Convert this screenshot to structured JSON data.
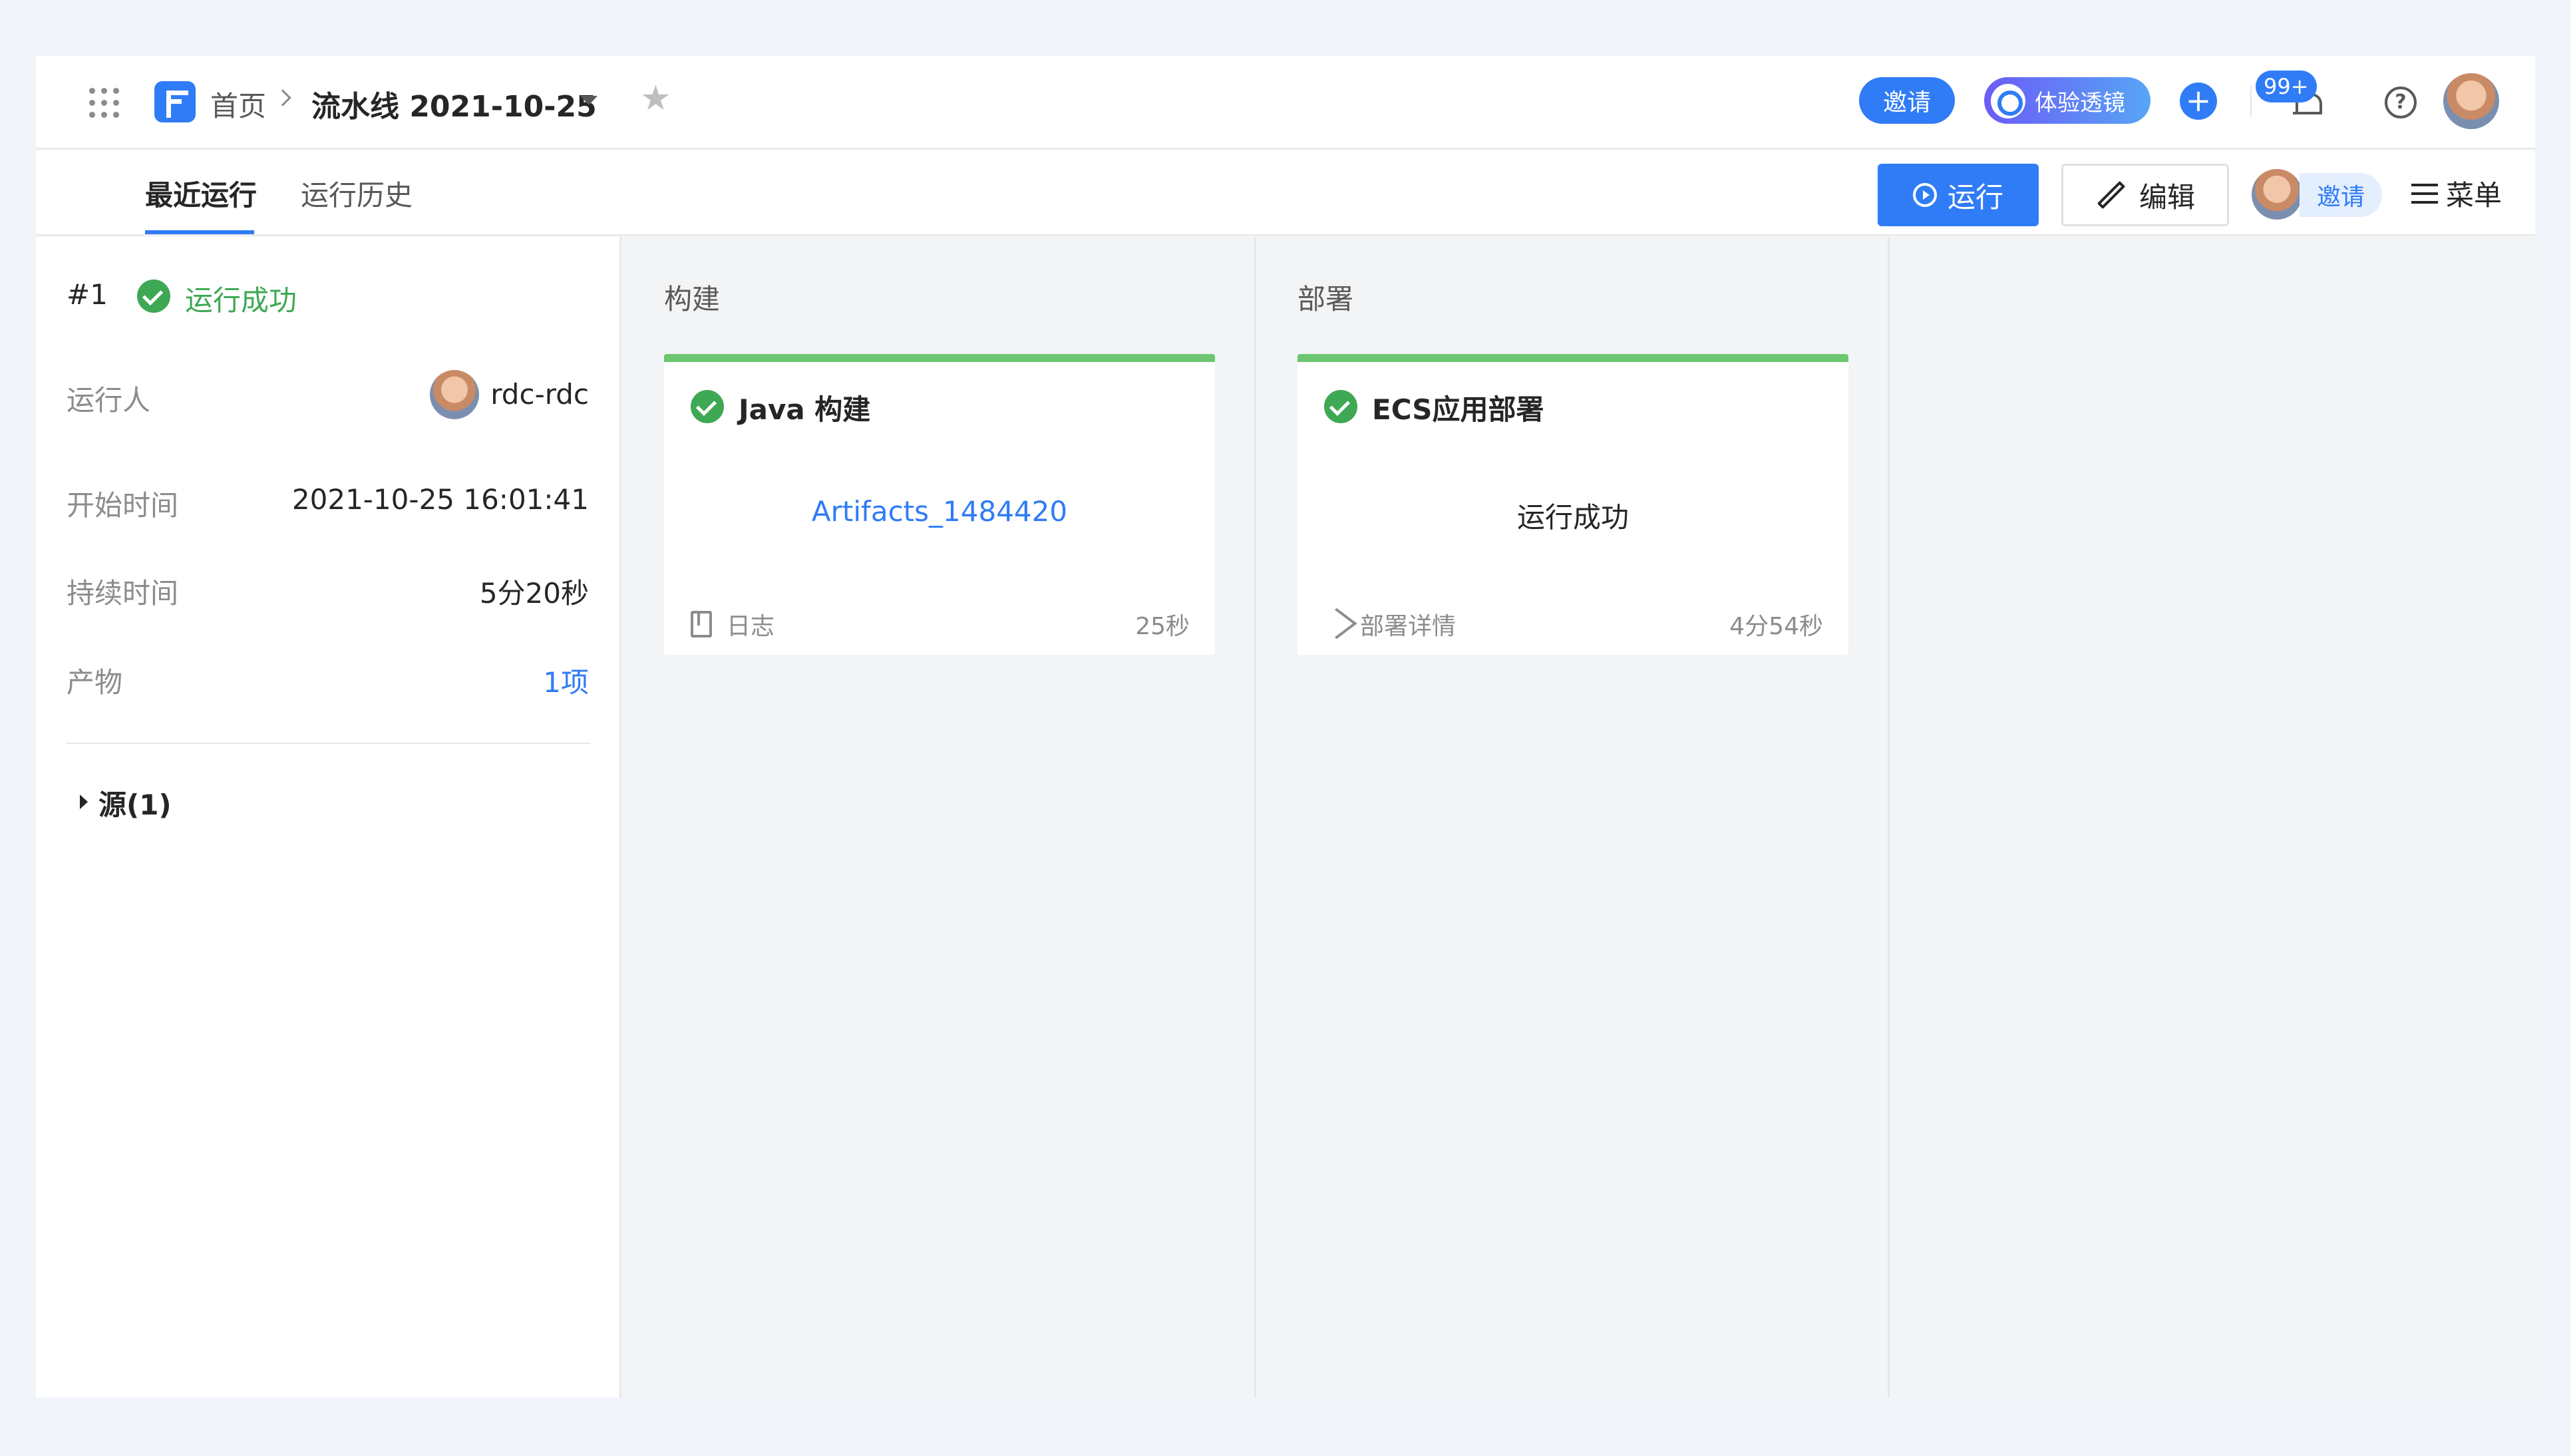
{
  "header": {
    "breadcrumb_home": "首页",
    "pipeline_name": "流水线 2021-10-25",
    "invite_label": "邀请",
    "lens_label": "体验透镜",
    "plus_label": "+",
    "notifications_badge": "99+",
    "help_label": "?"
  },
  "tabs": {
    "recent": "最近运行",
    "history": "运行历史",
    "run_button": "运行",
    "edit_button": "编辑",
    "invite_label": "邀请",
    "menu_label": "菜单"
  },
  "run_summary": {
    "run_number": "#1",
    "status": "运行成功",
    "runner_label": "运行人",
    "runner_value": "rdc-rdc",
    "start_label": "开始时间",
    "start_value": "2021-10-25 16:01:41",
    "duration_label": "持续时间",
    "duration_value": "5分20秒",
    "artifacts_label": "产物",
    "artifacts_value": "1项",
    "sources_label": "源(1)"
  },
  "stages": [
    {
      "title": "构建",
      "job_title": "Java 构建",
      "center_text": "Artifacts_1484420",
      "footer_left": "日志",
      "footer_right": "25秒"
    },
    {
      "title": "部署",
      "job_title": "ECS应用部署",
      "center_text": "运行成功",
      "footer_left": "部署详情",
      "footer_right": "4分54秒"
    }
  ],
  "colors": {
    "primary": "#2f7cf6",
    "success": "#3fa854",
    "stage_bar": "#6cc770"
  }
}
